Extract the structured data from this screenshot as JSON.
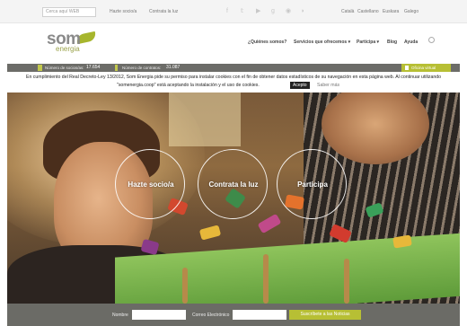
{
  "topbar": {
    "search_placeholder": "Cerca aquí WEB",
    "links": [
      "Hazte socio/a",
      "Contrata la luz"
    ],
    "social_icons": [
      "facebook-icon",
      "twitter-icon",
      "youtube-icon",
      "google-plus-icon",
      "flickr-icon",
      "rss-icon"
    ],
    "languages": [
      "Català",
      "Castellano",
      "Euskara",
      "Galego"
    ]
  },
  "logo": {
    "main": "som",
    "sub": "energia"
  },
  "nav": {
    "items": [
      "¿Quiénes somos?",
      "Servicios que ofrecemos",
      "Participa",
      "Blog",
      "Ayuda"
    ],
    "dropdown_marker": "▾"
  },
  "counter": {
    "members_label": "Número de socios/as:",
    "members_value": "17.654",
    "contracts_label": "Número de contratos:",
    "contracts_value": "31.087",
    "office_label": "Oficina virtual"
  },
  "cookie": {
    "line1": "En cumplimiento del Real Decreto-Ley 13/2012, Som Energia pide su permiso para instalar cookies con el fin de obtener datos estadísticos de su navegación en esta página web. Al continuar utilizando",
    "line2": "\"somenergia.coop\" está aceptando la instalación y el uso de cookies.",
    "accept": "Acepto",
    "more": "Saber más"
  },
  "hero": {
    "buttons": [
      "Hazte socio/a",
      "Contrata la luz",
      "Participa"
    ]
  },
  "newsletter": {
    "name_label": "Nombre",
    "email_label": "Correo Electrónico",
    "submit": "Suscríbete a las Noticias"
  },
  "colors": {
    "accent": "#b7bf34",
    "bar": "#6b6b66"
  }
}
